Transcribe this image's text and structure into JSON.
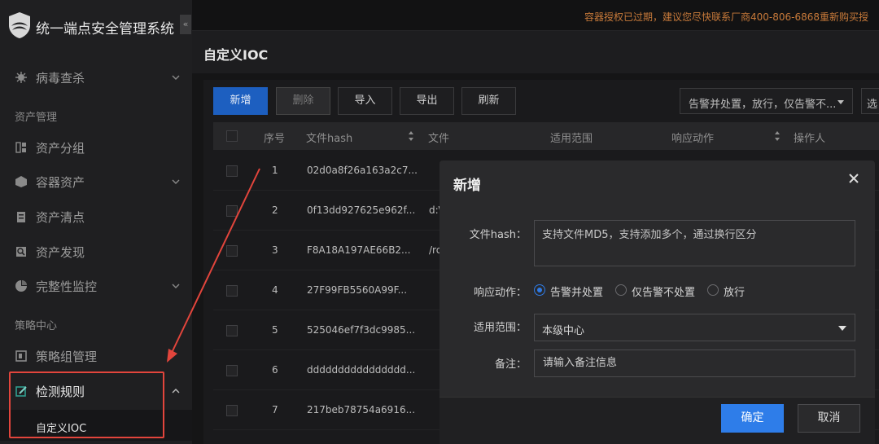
{
  "app": {
    "title": "统一端点安全管理系统",
    "collapse_glyph": "«"
  },
  "sidebar": {
    "items": [
      {
        "label": "病毒查杀",
        "icon": "virus-icon"
      },
      {
        "label": "资产分组",
        "icon": "group-icon"
      },
      {
        "label": "容器资产",
        "icon": "cube-icon"
      },
      {
        "label": "资产清点",
        "icon": "clipboard-icon"
      },
      {
        "label": "资产发现",
        "icon": "discover-icon"
      },
      {
        "label": "完整性监控",
        "icon": "pie-icon"
      },
      {
        "label": "策略组管理",
        "icon": "policy-icon"
      },
      {
        "label": "检测规则",
        "icon": "edit-icon"
      }
    ],
    "groups": [
      "资产管理",
      "策略中心"
    ],
    "subitem": "自定义IOC"
  },
  "topbar": {
    "warning": "容器授权已过期，建议您尽快联系厂商400-806-6868重新购买授"
  },
  "page": {
    "title": "自定义IOC"
  },
  "toolbar": {
    "add": "新增",
    "delete": "删除",
    "import": "导入",
    "export": "导出",
    "refresh": "刷新",
    "filter_value": "告警并处置，放行，仅告警不...",
    "filter2_value": "选"
  },
  "table": {
    "headers": {
      "index": "序号",
      "hash": "文件hash",
      "file": "文件",
      "scope": "适用范围",
      "action": "响应动作",
      "operator": "操作人"
    },
    "rows": [
      {
        "index": "1",
        "hash": "02d0a8f26a163a2c7...",
        "file": ""
      },
      {
        "index": "2",
        "hash": "0f13dd927625e962f...",
        "file": "d:\\"
      },
      {
        "index": "3",
        "hash": "F8A18A197AE66B2...",
        "file": "/rc"
      },
      {
        "index": "4",
        "hash": "27F99FB5560A99F...",
        "file": ""
      },
      {
        "index": "5",
        "hash": "525046ef7f3dc9985...",
        "file": ""
      },
      {
        "index": "6",
        "hash": "dddddddddddddddd...",
        "file": ""
      },
      {
        "index": "7",
        "hash": "217beb78754a6916...",
        "file": ""
      }
    ]
  },
  "modal": {
    "title": "新增",
    "hash_label": "文件hash：",
    "hash_placeholder": "支持文件MD5，支持添加多个，通过换行区分",
    "action_label": "响应动作：",
    "actions": [
      "告警并处置",
      "仅告警不处置",
      "放行"
    ],
    "selected_action": "告警并处置",
    "scope_label": "适用范围：",
    "scope_value": "本级中心",
    "note_label": "备注：",
    "note_placeholder": "请输入备注信息",
    "confirm": "确定",
    "cancel": "取消"
  },
  "colors": {
    "primary": "#2e7de9",
    "annotation": "#e2453c",
    "warning": "#c87a3a"
  }
}
